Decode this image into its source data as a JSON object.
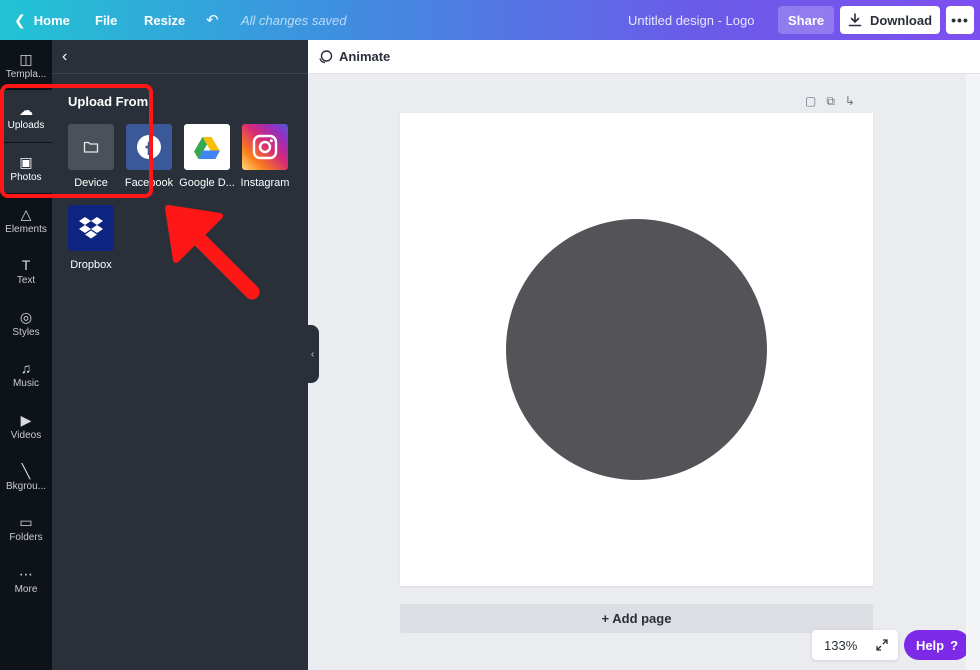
{
  "topbar": {
    "home_label": "Home",
    "file_label": "File",
    "resize_label": "Resize",
    "saved_status": "All changes saved",
    "design_title": "Untitled design - Logo",
    "share_label": "Share",
    "download_label": "Download",
    "more_label": "•••"
  },
  "rail": {
    "items": [
      {
        "label": "Templa...",
        "icon": "layout-icon"
      },
      {
        "label": "Uploads",
        "icon": "cloud-upload-icon"
      },
      {
        "label": "Photos",
        "icon": "image-icon"
      },
      {
        "label": "Elements",
        "icon": "shapes-icon"
      },
      {
        "label": "Text",
        "icon": "text-icon"
      },
      {
        "label": "Styles",
        "icon": "palette-icon"
      },
      {
        "label": "Music",
        "icon": "music-icon"
      },
      {
        "label": "Videos",
        "icon": "video-icon"
      },
      {
        "label": "Bkgrou...",
        "icon": "background-icon"
      },
      {
        "label": "Folders",
        "icon": "folder-icon"
      },
      {
        "label": "More",
        "icon": "more-icon"
      }
    ]
  },
  "panel": {
    "heading": "Upload From",
    "sources": [
      {
        "label": "Device",
        "icon": "folder-icon",
        "color": "#4a5159"
      },
      {
        "label": "Facebook",
        "icon": "facebook-icon",
        "color": "#3b5998"
      },
      {
        "label": "Google D...",
        "icon": "google-drive-icon",
        "color": "#ffffff"
      },
      {
        "label": "Instagram",
        "icon": "instagram-icon",
        "color": "#e1306c"
      },
      {
        "label": "Dropbox",
        "icon": "dropbox-icon",
        "color": "#0d2481"
      }
    ]
  },
  "canvas": {
    "animate_label": "Animate",
    "add_page_label": "+ Add page",
    "zoom_level": "133%",
    "help_label": "Help",
    "help_icon": "?",
    "shape_color": "#545358"
  },
  "colors": {
    "accent": "#7d2ae8",
    "highlight": "#ff1717"
  }
}
